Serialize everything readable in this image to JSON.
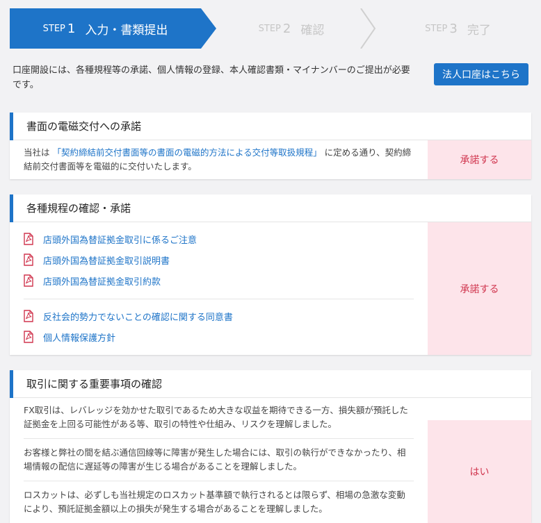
{
  "steps": [
    {
      "prefix": "STEP",
      "num": "1",
      "label": "入力・書類提出"
    },
    {
      "prefix": "STEP",
      "num": "2",
      "label": "確認"
    },
    {
      "prefix": "STEP",
      "num": "3",
      "label": "完了"
    }
  ],
  "intro": {
    "text": "口座開設には、各種規程等の承諾、個人情報の登録、本人確認書類・マイナンバーのご提出が必要です。",
    "corp_button": "法人口座はこちら"
  },
  "section1": {
    "title": "書面の電磁交付への承諾",
    "text_before": "当社は",
    "link": "「契約締結前交付書面等の書面の電磁的方法による交付等取扱規程」",
    "text_after": "に定める通り、契約締結前交付書面等を電磁的に交付いたします。",
    "action": "承諾する"
  },
  "section2": {
    "title": "各種規程の確認・承諾",
    "docs_a": [
      "店頭外国為替証拠金取引に係るご注意",
      "店頭外国為替証拠金取引説明書",
      "店頭外国為替証拠金取引約款"
    ],
    "docs_b": [
      "反社会的勢力でないことの確認に関する同意書",
      "個人情報保護方針"
    ],
    "action": "承諾する"
  },
  "section3": {
    "title": "取引に関する重要事項の確認",
    "items": [
      "FX取引は、レバレッジを効かせた取引であるため大きな収益を期待できる一方、損失額が預託した証拠金を上回る可能性がある等、取引の特性や仕組み、リスクを理解しました。",
      "お客様と弊社の間を結ぶ通信回線等に障害が発生した場合には、取引の執行ができなかったり、相場情報の配信に遅延等の障害が生じる場合があることを理解しました。",
      "ロスカットは、必ずしも当社規定のロスカット基準額で執行されるとは限らず、相場の急激な変動により、預託証拠金額以上の損失が発生する場合があることを理解しました。"
    ],
    "action": "はい"
  },
  "colors": {
    "accent": "#1e74c8",
    "consent_bg": "#fde4ea",
    "consent_text": "#d0354e",
    "pdf_icon": "#d0354e"
  }
}
